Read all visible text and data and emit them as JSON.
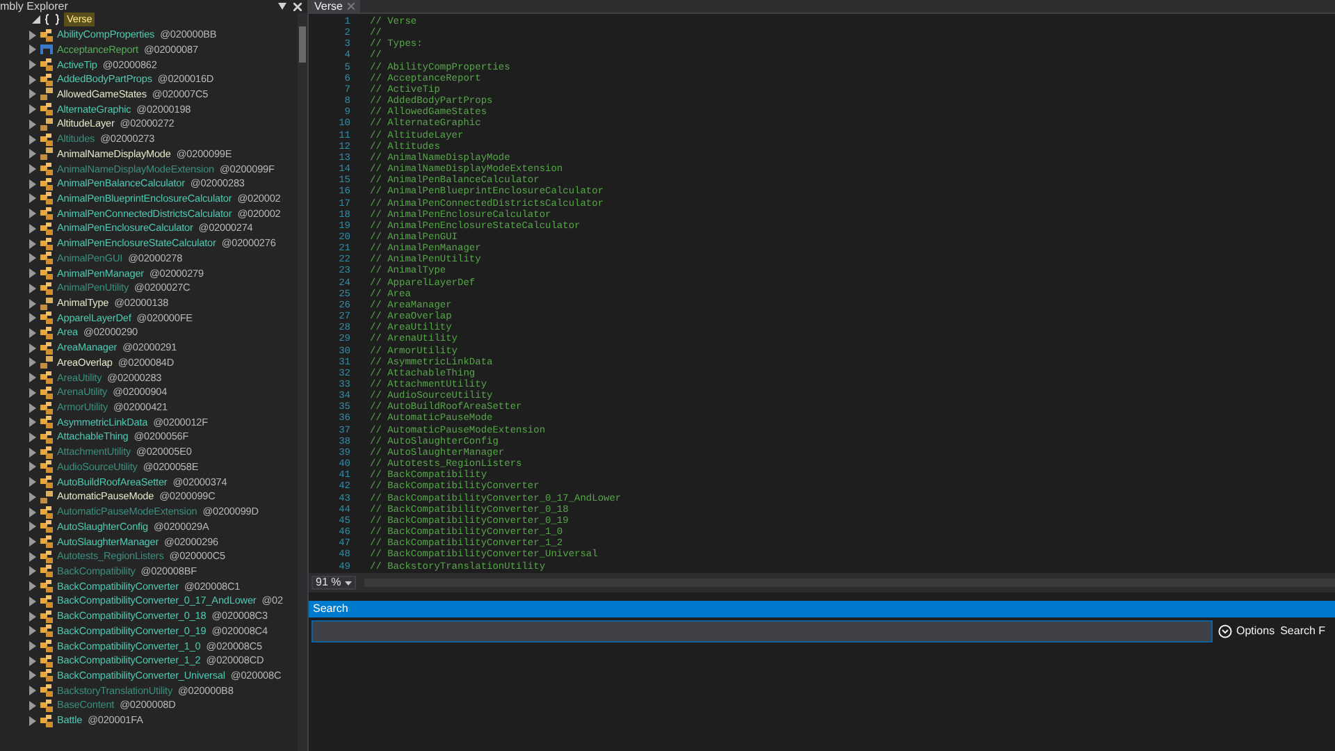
{
  "explorer": {
    "title": "mbly Explorer",
    "root": {
      "label": "Verse",
      "expanded": true,
      "selected": true
    },
    "items": [
      {
        "name": "AbilityCompProperties",
        "token": "@020000BB",
        "kind": "class",
        "expanded": false
      },
      {
        "name": "AcceptanceReport",
        "token": "@02000087",
        "kind": "struct",
        "expanded": false
      },
      {
        "name": "ActiveTip",
        "token": "@02000862",
        "kind": "class",
        "expanded": false
      },
      {
        "name": "AddedBodyPartProps",
        "token": "@0200016D",
        "kind": "class",
        "expanded": false
      },
      {
        "name": "AllowedGameStates",
        "token": "@020007C5",
        "kind": "enum",
        "expanded": false
      },
      {
        "name": "AlternateGraphic",
        "token": "@02000198",
        "kind": "class",
        "expanded": false
      },
      {
        "name": "AltitudeLayer",
        "token": "@02000272",
        "kind": "enum",
        "expanded": false
      },
      {
        "name": "Altitudes",
        "token": "@02000273",
        "kind": "static",
        "expanded": false
      },
      {
        "name": "AnimalNameDisplayMode",
        "token": "@0200099E",
        "kind": "enum",
        "expanded": false
      },
      {
        "name": "AnimalNameDisplayModeExtension",
        "token": "@0200099F",
        "kind": "static",
        "expanded": false
      },
      {
        "name": "AnimalPenBalanceCalculator",
        "token": "@02000283",
        "kind": "class",
        "expanded": false
      },
      {
        "name": "AnimalPenBlueprintEnclosureCalculator",
        "token": "@020002",
        "kind": "class",
        "expanded": false
      },
      {
        "name": "AnimalPenConnectedDistrictsCalculator",
        "token": "@020002",
        "kind": "class",
        "expanded": false
      },
      {
        "name": "AnimalPenEnclosureCalculator",
        "token": "@02000274",
        "kind": "class",
        "expanded": false
      },
      {
        "name": "AnimalPenEnclosureStateCalculator",
        "token": "@02000276",
        "kind": "class",
        "expanded": false
      },
      {
        "name": "AnimalPenGUI",
        "token": "@02000278",
        "kind": "static",
        "expanded": false
      },
      {
        "name": "AnimalPenManager",
        "token": "@02000279",
        "kind": "class",
        "expanded": false
      },
      {
        "name": "AnimalPenUtility",
        "token": "@0200027C",
        "kind": "static",
        "expanded": false
      },
      {
        "name": "AnimalType",
        "token": "@02000138",
        "kind": "enum",
        "expanded": false
      },
      {
        "name": "ApparelLayerDef",
        "token": "@020000FE",
        "kind": "class",
        "expanded": false
      },
      {
        "name": "Area",
        "token": "@02000290",
        "kind": "class",
        "expanded": false
      },
      {
        "name": "AreaManager",
        "token": "@02000291",
        "kind": "class",
        "expanded": false
      },
      {
        "name": "AreaOverlap",
        "token": "@0200084D",
        "kind": "enum",
        "expanded": false
      },
      {
        "name": "AreaUtility",
        "token": "@02000283",
        "kind": "static",
        "expanded": false
      },
      {
        "name": "ArenaUtility",
        "token": "@02000904",
        "kind": "static",
        "expanded": false
      },
      {
        "name": "ArmorUtility",
        "token": "@02000421",
        "kind": "static",
        "expanded": false
      },
      {
        "name": "AsymmetricLinkData",
        "token": "@0200012F",
        "kind": "class",
        "expanded": false
      },
      {
        "name": "AttachableThing",
        "token": "@0200056F",
        "kind": "class",
        "expanded": false
      },
      {
        "name": "AttachmentUtility",
        "token": "@020005E0",
        "kind": "static",
        "expanded": false
      },
      {
        "name": "AudioSourceUtility",
        "token": "@0200058E",
        "kind": "static",
        "expanded": false
      },
      {
        "name": "AutoBuildRoofAreaSetter",
        "token": "@02000374",
        "kind": "class",
        "expanded": false
      },
      {
        "name": "AutomaticPauseMode",
        "token": "@0200099C",
        "kind": "enum",
        "expanded": false
      },
      {
        "name": "AutomaticPauseModeExtension",
        "token": "@0200099D",
        "kind": "static",
        "expanded": false
      },
      {
        "name": "AutoSlaughterConfig",
        "token": "@0200029A",
        "kind": "class",
        "expanded": false
      },
      {
        "name": "AutoSlaughterManager",
        "token": "@02000296",
        "kind": "class",
        "expanded": false
      },
      {
        "name": "Autotests_RegionListers",
        "token": "@020000C5",
        "kind": "static",
        "expanded": false
      },
      {
        "name": "BackCompatibility",
        "token": "@020008BF",
        "kind": "static",
        "expanded": false
      },
      {
        "name": "BackCompatibilityConverter",
        "token": "@020008C1",
        "kind": "class",
        "expanded": false
      },
      {
        "name": "BackCompatibilityConverter_0_17_AndLower",
        "token": "@02",
        "kind": "class",
        "expanded": false
      },
      {
        "name": "BackCompatibilityConverter_0_18",
        "token": "@020008C3",
        "kind": "class",
        "expanded": false
      },
      {
        "name": "BackCompatibilityConverter_0_19",
        "token": "@020008C4",
        "kind": "class",
        "expanded": false
      },
      {
        "name": "BackCompatibilityConverter_1_0",
        "token": "@020008C5",
        "kind": "class",
        "expanded": false
      },
      {
        "name": "BackCompatibilityConverter_1_2",
        "token": "@020008CD",
        "kind": "class",
        "expanded": false
      },
      {
        "name": "BackCompatibilityConverter_Universal",
        "token": "@020008C",
        "kind": "class",
        "expanded": false
      },
      {
        "name": "BackstoryTranslationUtility",
        "token": "@020000B8",
        "kind": "static",
        "expanded": false
      },
      {
        "name": "BaseContent",
        "token": "@0200008D",
        "kind": "static",
        "expanded": false
      },
      {
        "name": "Battle",
        "token": "@020001FA",
        "kind": "class",
        "expanded": false
      }
    ]
  },
  "editor": {
    "tab": "Verse",
    "zoom": "91 %",
    "lines": [
      {
        "number": "1",
        "text": "// Verse"
      },
      {
        "number": "2",
        "text": "//"
      },
      {
        "number": "3",
        "text": "// Types:"
      },
      {
        "number": "4",
        "text": "//"
      },
      {
        "number": "5",
        "text": "// AbilityCompProperties"
      },
      {
        "number": "6",
        "text": "// AcceptanceReport"
      },
      {
        "number": "7",
        "text": "// ActiveTip"
      },
      {
        "number": "8",
        "text": "// AddedBodyPartProps"
      },
      {
        "number": "9",
        "text": "// AllowedGameStates"
      },
      {
        "number": "10",
        "text": "// AlternateGraphic"
      },
      {
        "number": "11",
        "text": "// AltitudeLayer"
      },
      {
        "number": "12",
        "text": "// Altitudes"
      },
      {
        "number": "13",
        "text": "// AnimalNameDisplayMode"
      },
      {
        "number": "14",
        "text": "// AnimalNameDisplayModeExtension"
      },
      {
        "number": "15",
        "text": "// AnimalPenBalanceCalculator"
      },
      {
        "number": "16",
        "text": "// AnimalPenBlueprintEnclosureCalculator"
      },
      {
        "number": "17",
        "text": "// AnimalPenConnectedDistrictsCalculator"
      },
      {
        "number": "18",
        "text": "// AnimalPenEnclosureCalculator"
      },
      {
        "number": "19",
        "text": "// AnimalPenEnclosureStateCalculator"
      },
      {
        "number": "20",
        "text": "// AnimalPenGUI"
      },
      {
        "number": "21",
        "text": "// AnimalPenManager"
      },
      {
        "number": "22",
        "text": "// AnimalPenUtility"
      },
      {
        "number": "23",
        "text": "// AnimalType"
      },
      {
        "number": "24",
        "text": "// ApparelLayerDef"
      },
      {
        "number": "25",
        "text": "// Area"
      },
      {
        "number": "26",
        "text": "// AreaManager"
      },
      {
        "number": "27",
        "text": "// AreaOverlap"
      },
      {
        "number": "28",
        "text": "// AreaUtility"
      },
      {
        "number": "29",
        "text": "// ArenaUtility"
      },
      {
        "number": "30",
        "text": "// ArmorUtility"
      },
      {
        "number": "31",
        "text": "// AsymmetricLinkData"
      },
      {
        "number": "32",
        "text": "// AttachableThing"
      },
      {
        "number": "33",
        "text": "// AttachmentUtility"
      },
      {
        "number": "34",
        "text": "// AudioSourceUtility"
      },
      {
        "number": "35",
        "text": "// AutoBuildRoofAreaSetter"
      },
      {
        "number": "36",
        "text": "// AutomaticPauseMode"
      },
      {
        "number": "37",
        "text": "// AutomaticPauseModeExtension"
      },
      {
        "number": "38",
        "text": "// AutoSlaughterConfig"
      },
      {
        "number": "39",
        "text": "// AutoSlaughterManager"
      },
      {
        "number": "40",
        "text": "// Autotests_RegionListers"
      },
      {
        "number": "41",
        "text": "// BackCompatibility"
      },
      {
        "number": "42",
        "text": "// BackCompatibilityConverter"
      },
      {
        "number": "43",
        "text": "// BackCompatibilityConverter_0_17_AndLower"
      },
      {
        "number": "44",
        "text": "// BackCompatibilityConverter_0_18"
      },
      {
        "number": "45",
        "text": "// BackCompatibilityConverter_0_19"
      },
      {
        "number": "46",
        "text": "// BackCompatibilityConverter_1_0"
      },
      {
        "number": "47",
        "text": "// BackCompatibilityConverter_1_2"
      },
      {
        "number": "48",
        "text": "// BackCompatibilityConverter_Universal"
      },
      {
        "number": "49",
        "text": "// BackstoryTranslationUtility"
      }
    ]
  },
  "search": {
    "title": "Search",
    "options": "Options",
    "scope": "Search F"
  }
}
